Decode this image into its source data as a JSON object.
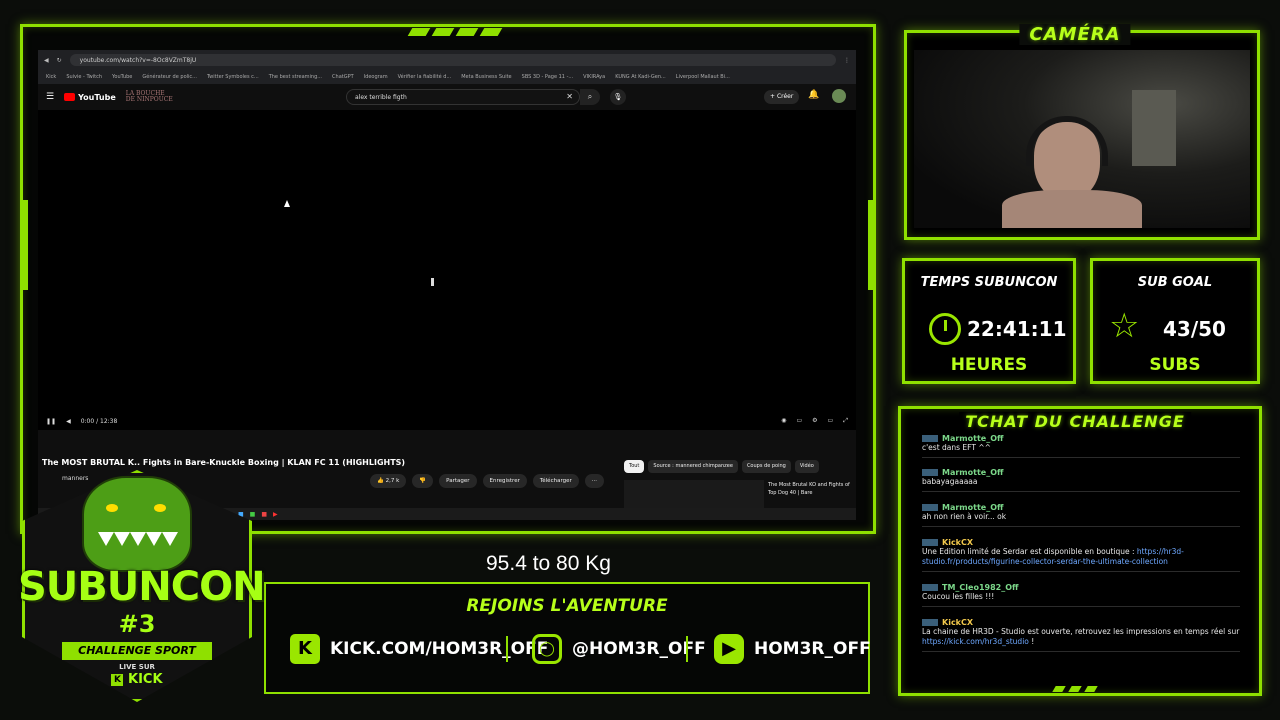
{
  "browser": {
    "url": "youtube.com/watch?v=-8Oc8VZmT8jU",
    "bookmarks": [
      "Kick",
      "Suivie - Twitch",
      "YouTube",
      "Générateur de polic...",
      "Twitter Symboles c...",
      "The best streaming...",
      "ChatGPT",
      "Ideogram",
      "Vérifier la fiabilité d...",
      "Meta Business Suite",
      "SBS 3D - Page 11 -...",
      "VIKIRAya",
      "KUNG At Kadi-Gen...",
      "Liverpool Mallaut Bi..."
    ],
    "overlay_text": "LA BOUCHE DE NINPOUCE"
  },
  "youtube": {
    "logo": "YouTube",
    "search_value": "alex terrible figth",
    "create_label": "Créer",
    "notif_count": "9+",
    "time": "0:00 / 12:38",
    "title": "The MOST BRUTAL K.. Fights in Bare-Knuckle Boxing | KLAN FC 11 (HIGHLIGHTS)",
    "channel": "manners",
    "likes": "2,7 k",
    "share": "Partager",
    "save": "Enregistrer",
    "download": "Télécharger",
    "chips": [
      "Tout",
      "Source : mannered chimpanzee",
      "Coups de poing",
      "Vidéo"
    ],
    "rec_title": "The Most Brutal KO and Fights of Top Dog 40 | Bare"
  },
  "camera": {
    "title": "CAMÉRA"
  },
  "timer": {
    "title": "TEMPS SUBUNCON",
    "value": "22:41:11",
    "unit": "HEURES"
  },
  "subgoal": {
    "title": "SUB GOAL",
    "value": "43/50",
    "unit": "SUBS"
  },
  "chat": {
    "title": "TCHAT DU CHALLENGE",
    "messages": [
      {
        "user": "Marmotte_Off",
        "text": "c'est dans EFT ^^"
      },
      {
        "user": "Marmotte_Off",
        "text": "babayagaaaaa"
      },
      {
        "user": "Marmotte_Off",
        "text": "ah non rien à voir... ok"
      },
      {
        "user": "KickCX",
        "text": "Une Edition limité de Serdar est disponible en boutique : ",
        "link": "https://hr3d-studio.fr/products/figurine-collector-serdar-the-ultimate-collection"
      },
      {
        "user": "TM_Cleo1982_Off",
        "text": "Coucou les filles !!!"
      },
      {
        "user": "KickCX",
        "text": "La chaine de HR3D - Studio est ouverte, retrouvez les impressions en temps réel sur ",
        "link": "https://kick.com/hr3d_studio",
        "suffix": " !"
      }
    ]
  },
  "caption": "95.4 to 80 Kg",
  "banner": {
    "title": "REJOINS L'AVENTURE",
    "kick": "KICK.COM/HOM3R_OFF",
    "instagram": "@HOM3R_OFF",
    "youtube": "HOM3R_OFF"
  },
  "logo": {
    "name_part1": "SUB",
    "name_part2": "UNCON",
    "number": "#3",
    "tagline": "CHALLENGE SPORT",
    "live_on": "LIVE SUR",
    "platform": "KICK"
  },
  "colors": {
    "accent": "#8fe000",
    "accent_bright": "#b7ff1a",
    "background": "#0b0d0a"
  }
}
